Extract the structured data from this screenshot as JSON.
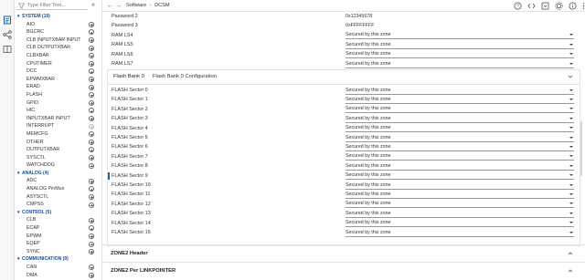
{
  "toolbar": {
    "breadcrumb_root": "Software",
    "breadcrumb_sep": "›",
    "breadcrumb_leaf": "DCSM",
    "back_glyph": "←",
    "forward_glyph": "→"
  },
  "rail": {
    "icons": [
      "files-icon",
      "hierarchy-icon",
      "book-icon"
    ]
  },
  "sidebar": {
    "filter_placeholder": "Type Filter Text...",
    "collapse_glyph": "«",
    "categories": [
      {
        "label": "SYSTEM (19)",
        "items": [
          "AIO",
          "BGCRC",
          "CLB INPUTXBAR INPUT",
          "CLB OUTPUTXBAR",
          "CLBXBAR",
          "CPUTIMER",
          "DCC",
          "EPWMXBAR",
          "ERAD",
          "FLASH",
          "GPIO",
          "HIC",
          "INPUTXBAR INPUT",
          "INTERRUPT",
          "MEMCFG",
          "OTHER",
          "OUTPUTXBAR",
          "SYSCTL",
          "WATCHDOG"
        ]
      },
      {
        "label": "ANALOG (4)",
        "items": [
          "ADC",
          "ANALOG PinMux",
          "ASYSCTL",
          "CMPSS"
        ]
      },
      {
        "label": "CONTROL (5)",
        "items": [
          "CLB",
          "ECAP",
          "EPWM",
          "EQEP",
          "SYNC"
        ]
      },
      {
        "label": "COMMUNICATION (9)",
        "items": [
          "CAN",
          "DMA"
        ]
      }
    ]
  },
  "config": {
    "top_rows": [
      {
        "label": "Password 2",
        "value": "0x12345678",
        "type": "text"
      },
      {
        "label": "Password 3",
        "value": "0xFFFFFFFF",
        "type": "text"
      },
      {
        "label": "RAM LS4",
        "value": "Secured by this zone",
        "type": "select"
      },
      {
        "label": "RAM LS5",
        "value": "Secured by this zone",
        "type": "select"
      },
      {
        "label": "RAM LS6",
        "value": "Secured by this zone",
        "type": "select"
      },
      {
        "label": "RAM LS7",
        "value": "Secured by this zone",
        "type": "select"
      }
    ],
    "bank": {
      "name": "Flash Bank 0",
      "title": "Flash Bank 0 Configuration",
      "sectors": [
        {
          "label": "FLASH Sector 0",
          "value": "Secured by this zone"
        },
        {
          "label": "FLASH Sector 1",
          "value": "Secured by this zone"
        },
        {
          "label": "FLASH Sector 2",
          "value": "Secured by this zone"
        },
        {
          "label": "FLASH Sector 3",
          "value": "Secured by this zone"
        },
        {
          "label": "FLASH Sector 4",
          "value": "Secured by this zone"
        },
        {
          "label": "FLASH Sector 5",
          "value": "Secured by this zone"
        },
        {
          "label": "FLASH Sector 6",
          "value": "Secured by this zone"
        },
        {
          "label": "FLASH Sector 7",
          "value": "Secured by this zone"
        },
        {
          "label": "FLASH Sector 8",
          "value": "Secured by this zone"
        },
        {
          "label": "FLASH Sector 9",
          "value": "Secured by this zone"
        },
        {
          "label": "FLASH Sector 10",
          "value": "Secured by this zone"
        },
        {
          "label": "FLASH Sector 11",
          "value": "Secured by this zone"
        },
        {
          "label": "FLASH Sector 12",
          "value": "Secured by this zone"
        },
        {
          "label": "FLASH Sector 13",
          "value": "Secured by this zone"
        },
        {
          "label": "FLASH Sector 14",
          "value": "Secured by this zone"
        },
        {
          "label": "FLASH Sector 15",
          "value": "Secured by this zone"
        }
      ]
    },
    "sections": [
      "ZONE2 Header",
      "ZONE2 Per LINKPOINTER"
    ]
  },
  "colors": {
    "accent": "#1d5e9c",
    "category": "#1a4f8c"
  }
}
